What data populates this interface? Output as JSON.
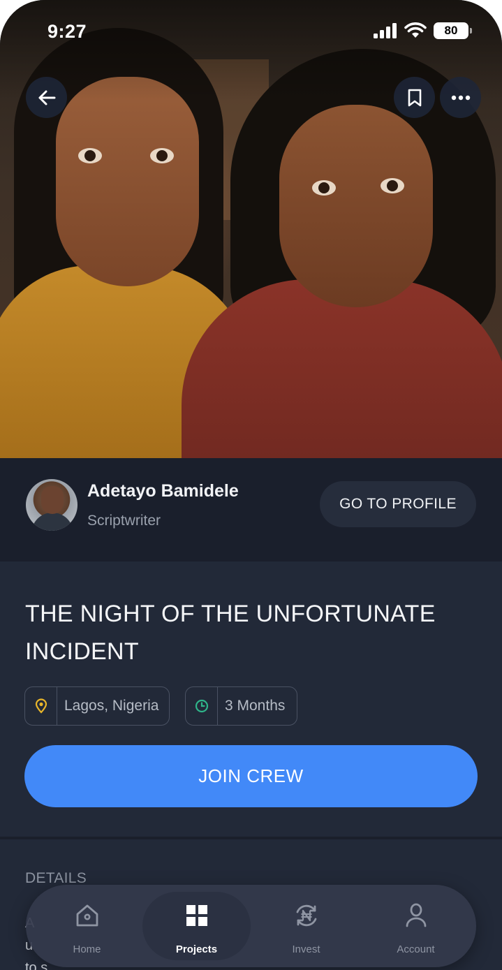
{
  "status_bar": {
    "time": "9:27",
    "battery": "80"
  },
  "hero": {
    "image_description_icon": "poster-image"
  },
  "author": {
    "name": "Adetayo Bamidele",
    "role": "Scriptwriter",
    "profile_button": "GO TO PROFILE"
  },
  "project": {
    "title": "THE NIGHT OF THE UNFORTUNATE INCIDENT",
    "location": "Lagos, Nigeria",
    "duration": "3 Months",
    "join_button": "JOIN CREW"
  },
  "details": {
    "label": "DETAILS",
    "text_fragments": [
      "A",
      "u",
      "to s"
    ]
  },
  "nav": {
    "items": [
      {
        "label": "Home",
        "icon": "home-icon"
      },
      {
        "label": "Projects",
        "icon": "grid-icon"
      },
      {
        "label": "Invest",
        "icon": "naira-cycle-icon"
      },
      {
        "label": "Account",
        "icon": "user-icon"
      }
    ],
    "active": "Projects"
  },
  "colors": {
    "accent": "#4289f8",
    "background": "#222938",
    "location_icon": "#e8b52a",
    "clock_icon": "#2fb58a"
  }
}
